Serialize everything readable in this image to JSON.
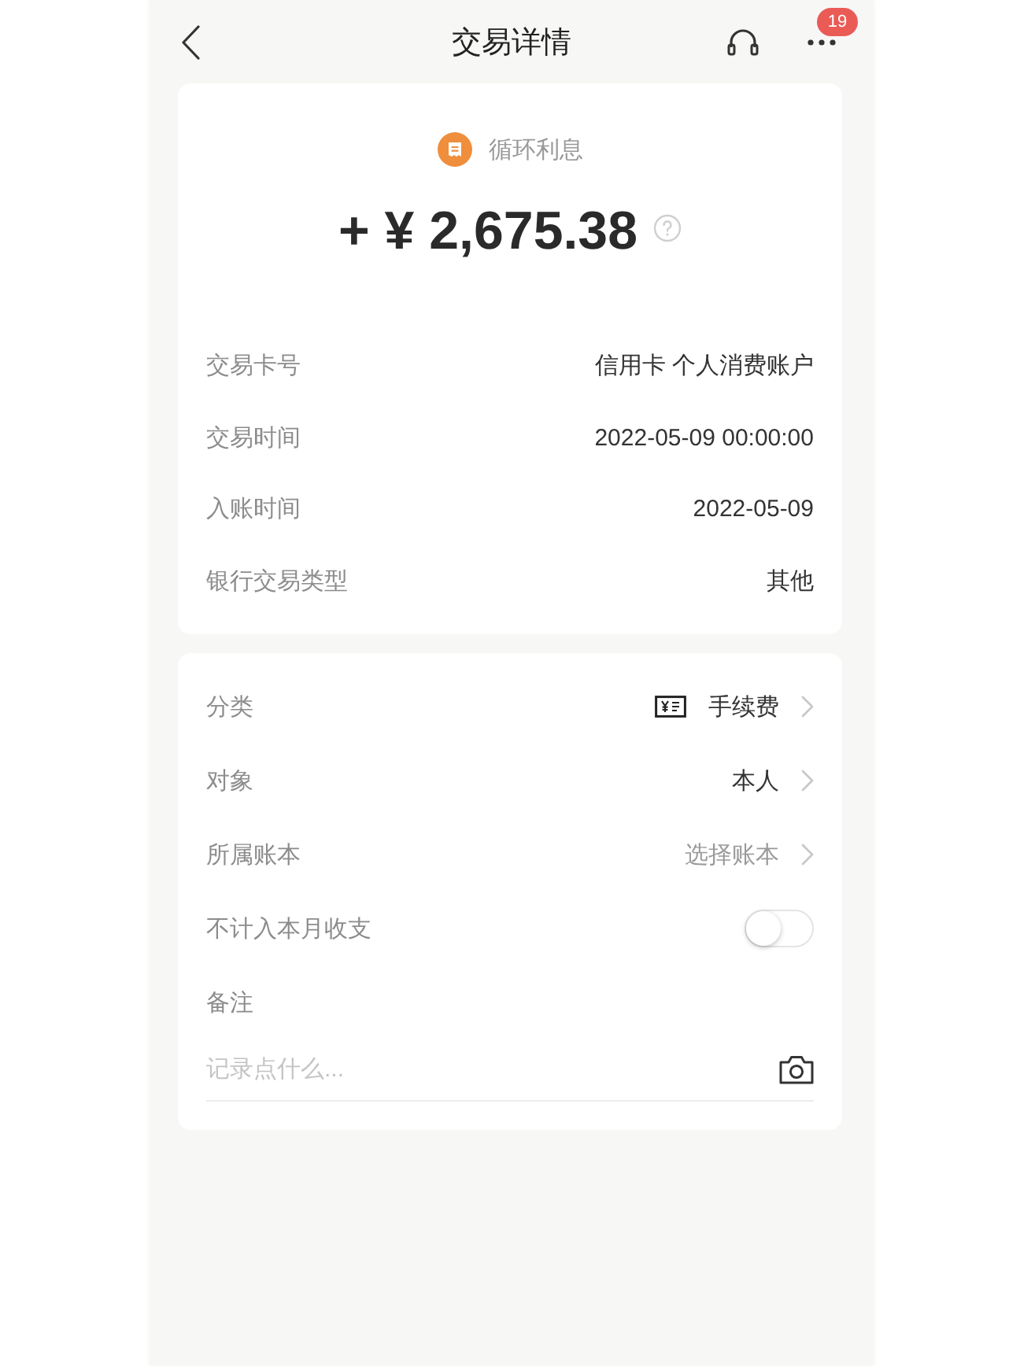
{
  "nav": {
    "title": "交易详情",
    "badge": "19"
  },
  "summary": {
    "category": "循环利息",
    "amount": "+ ¥ 2,675.38"
  },
  "details": [
    {
      "label": "交易卡号",
      "value": "信用卡 个人消费账户"
    },
    {
      "label": "交易时间",
      "value": "2022-05-09 00:00:00"
    },
    {
      "label": "入账时间",
      "value": "2022-05-09"
    },
    {
      "label": "银行交易类型",
      "value": "其他"
    }
  ],
  "settings": [
    {
      "kind": "category",
      "label": "分类",
      "value": "手续费",
      "empty": false
    },
    {
      "kind": "link",
      "label": "对象",
      "value": "本人",
      "empty": false
    },
    {
      "kind": "link",
      "label": "所属账本",
      "value": "选择账本",
      "empty": true
    },
    {
      "kind": "toggle",
      "label": "不计入本月收支",
      "on": false
    },
    {
      "kind": "note",
      "label": "备注",
      "placeholder": "记录点什么..."
    }
  ]
}
